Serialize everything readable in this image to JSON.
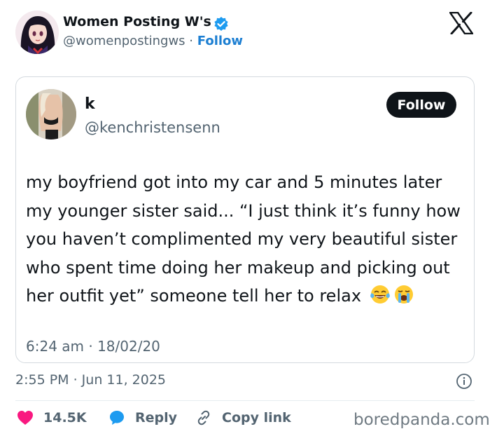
{
  "outer": {
    "name": "Women Posting W's",
    "handle": "@womenpostingws",
    "separator": "·",
    "follow_label": "Follow",
    "timestamp": "2:55 PM · Jun 11, 2025"
  },
  "quoted": {
    "name": "k",
    "handle": "@kenchristensenn",
    "follow_label": "Follow",
    "lines": [
      "my boyfriend got into my car and 5 minutes later",
      "my younger sister said... “I just think it’s funny how",
      "you haven’t complimented my very beautiful sister",
      "who spent time doing her makeup and picking out",
      "her outfit yet” someone tell her to relax"
    ],
    "emojis": [
      "face-with-tears-of-joy-icon",
      "loudly-crying-face-icon"
    ],
    "timestamp": "6:24 am · 18/02/20"
  },
  "actions": {
    "like_count": "14.5K",
    "reply_label": "Reply",
    "copy_label": "Copy link"
  },
  "watermark": "boredpanda.com",
  "colors": {
    "accent_blue": "#1d9bf0",
    "follow_link": "#1d7fd2",
    "like_red": "#f91880",
    "text_primary": "#0f1419",
    "text_secondary": "#536471"
  }
}
